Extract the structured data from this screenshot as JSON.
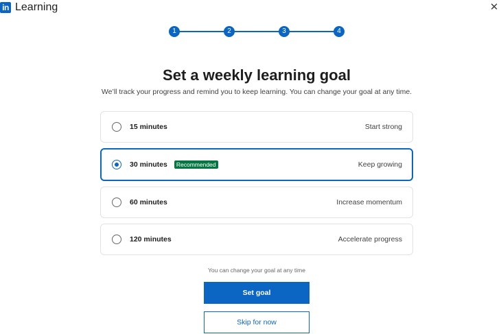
{
  "header": {
    "logo_mark": "in",
    "logo_text": "Learning",
    "close_glyph": "✕"
  },
  "stepper": {
    "steps": [
      "1",
      "2",
      "3",
      "4"
    ],
    "current_step": 4
  },
  "main": {
    "title": "Set a weekly learning goal",
    "subtitle": "We’ll track your progress and remind you to keep learning. You can change your goal at any time."
  },
  "options": [
    {
      "label": "15 minutes",
      "description": "Start strong",
      "selected": false,
      "badge": ""
    },
    {
      "label": "30 minutes",
      "description": "Keep growing",
      "selected": true,
      "badge": "Recommended"
    },
    {
      "label": "60 minutes",
      "description": "Increase momentum",
      "selected": false,
      "badge": ""
    },
    {
      "label": "120 minutes",
      "description": "Accelerate progress",
      "selected": false,
      "badge": ""
    }
  ],
  "footer": {
    "note": "You can change your goal at any time",
    "primary_label": "Set goal",
    "secondary_label": "Skip for now"
  },
  "colors": {
    "brand_blue": "#0a66c2",
    "badge_green": "#057642"
  }
}
